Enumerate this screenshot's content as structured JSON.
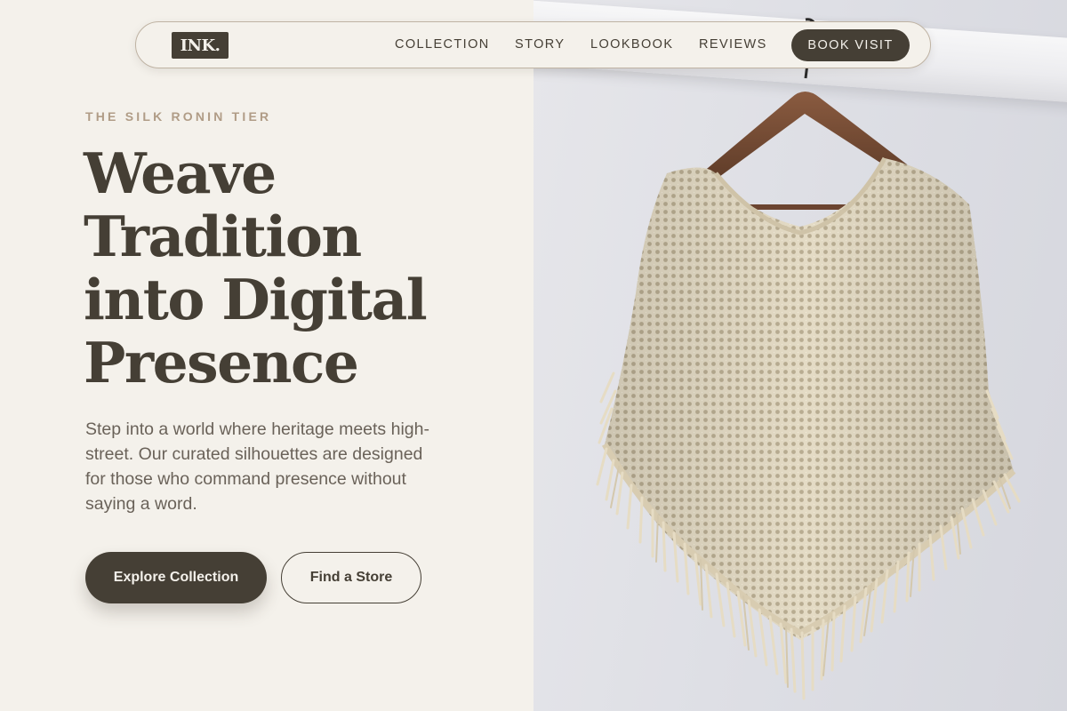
{
  "nav": {
    "logo": "INK.",
    "links": [
      "COLLECTION",
      "STORY",
      "LOOKBOOK",
      "REVIEWS"
    ],
    "cta": "BOOK VISIT"
  },
  "hero": {
    "eyebrow": "THE SILK RONIN TIER",
    "headline_lines": [
      "Weave",
      "Tradition",
      "into Digital",
      "Presence"
    ],
    "intro": "Step into a world where heritage meets high-street. Our curated silhouettes are designed for those who command presence without saying a word.",
    "primary_button": "Explore Collection",
    "secondary_button": "Find a Store"
  },
  "colors": {
    "background": "#f4f1eb",
    "ink": "#453f35",
    "accent": "#b09c86",
    "body_text": "#6a6259"
  },
  "image": {
    "subject": "cream-crochet-poncho-on-wooden-hanger"
  }
}
